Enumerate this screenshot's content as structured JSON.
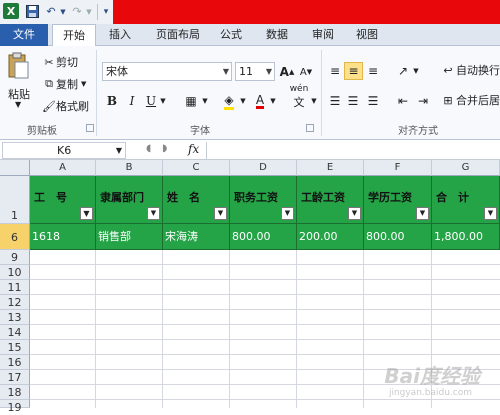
{
  "quick_access": {
    "logo": "X"
  },
  "tabs": [
    "文件",
    "开始",
    "插入",
    "页面布局",
    "公式",
    "数据",
    "审阅",
    "视图"
  ],
  "clipboard": {
    "paste": "粘贴",
    "cut": "剪切",
    "copy": "复制",
    "format_painter": "格式刷",
    "group": "剪贴板"
  },
  "font": {
    "name": "宋体",
    "size": "11",
    "bold": "B",
    "italic": "I",
    "underline": "U",
    "grow": "A",
    "shrink": "A",
    "font_color": "A",
    "wen": "wén",
    "group": "字体"
  },
  "alignment": {
    "wrap": "自动换行",
    "merge": "合并后居",
    "group": "对齐方式"
  },
  "formula_bar": {
    "name_box": "K6",
    "fx": "fx"
  },
  "columns": [
    "A",
    "B",
    "C",
    "D",
    "E",
    "F",
    "G"
  ],
  "rows": [
    "1",
    "6",
    "9",
    "10",
    "11",
    "12",
    "13",
    "14",
    "15",
    "16",
    "17",
    "18",
    "19"
  ],
  "header_cells": [
    "工　号",
    "隶属部门",
    "姓　名",
    "职务工资",
    "工龄工资",
    "学历工资",
    "合　计"
  ],
  "data_row": [
    "1618",
    "销售部",
    "宋海涛",
    "800.00",
    "200.00",
    "800.00",
    "1,800.00"
  ],
  "watermark": {
    "text": "Bai度经验",
    "sub": "jingyan.baidu.com"
  },
  "colors": {
    "header_green": "#25a347",
    "title_red": "#e8080c",
    "file_tab": "#2a5fad"
  }
}
